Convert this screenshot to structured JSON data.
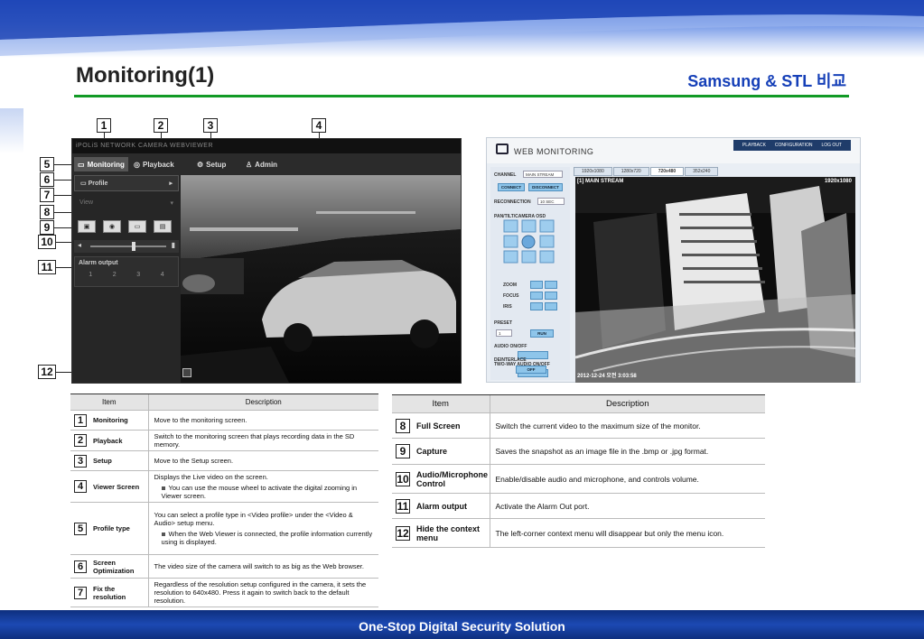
{
  "slide": {
    "title": "Monitoring(1)",
    "subtitle": "Samsung & STL 비교",
    "footer": "One-Stop Digital Security Solution"
  },
  "viewer": {
    "brand": "iPOLiS NETWORK CAMERA WEBVIEWER",
    "tabs": [
      "Monitoring",
      "Playback",
      "Setup",
      "Admin"
    ],
    "profile_label": "Profile",
    "view_label": "View",
    "buttons": [
      "▣",
      "◉",
      "▭",
      "▤"
    ],
    "alarm_title": "Alarm output",
    "alarm_cells": [
      "1",
      "2",
      "3",
      "4"
    ],
    "callouts": [
      "1",
      "2",
      "3",
      "4",
      "5",
      "6",
      "7",
      "8",
      "9",
      "10",
      "11",
      "12"
    ]
  },
  "web_monitoring": {
    "title": "WEB MONITORING",
    "menu": [
      "PLAYBACK",
      "CONFIGURATION",
      "LOG OUT"
    ],
    "tabs": [
      "1920x1080",
      "1280x720",
      "720x480",
      "352x240"
    ],
    "labels": {
      "channel": "CHANNEL",
      "channel_value": "MAIN STREAM",
      "connect": "CONNECT",
      "disconnect": "DISCONNECT",
      "reconnection": "RECONNECTION",
      "reconnection_value": "10 SEC",
      "ptz": "PAN/TILT/CAMERA OSD",
      "zoom": "ZOOM",
      "focus": "FOCUS",
      "iris": "IRIS",
      "preset": "PRESET",
      "preset_value": "1",
      "run": "RUN",
      "audio": "AUDIO ON/OFF",
      "two_way": "TWO-WAY AUDIO ON/OFF",
      "deinterlace": "DEINTERLACE",
      "off": "OFF"
    },
    "overlay": {
      "stream": "[1] MAIN STREAM",
      "resolution": "1920x1080",
      "timestamp": "2012-12-24 오전 3:03:58"
    }
  },
  "table_left": {
    "headers": {
      "item": "Item",
      "description": "Description"
    },
    "rows": [
      {
        "num": "1",
        "item": "Monitoring",
        "desc": "Move to the monitoring screen.",
        "note": ""
      },
      {
        "num": "2",
        "item": "Playback",
        "desc": "Switch to the monitoring screen that plays recording data in the SD memory.",
        "note": ""
      },
      {
        "num": "3",
        "item": "Setup",
        "desc": "Move to the Setup screen.",
        "note": ""
      },
      {
        "num": "4",
        "item": "Viewer Screen",
        "desc": "Displays the Live video on the screen.",
        "note": "You can use the mouse wheel to activate the digital zooming in Viewer screen."
      },
      {
        "num": "5",
        "item": "Profile type",
        "desc": "You can select a profile type in <Video profile> under the <Video & Audio> setup menu.",
        "note": "When the Web Viewer is connected, the profile information currently using is displayed."
      },
      {
        "num": "6",
        "item": "Screen Optimization",
        "desc": "The video size of the camera will switch to as big as the Web browser.",
        "note": ""
      },
      {
        "num": "7",
        "item": "Fix the resolution",
        "desc": "Regardless of the resolution setup configured in the camera, it sets the resolution to 640x480. Press it again to switch back to the default resolution.",
        "note": ""
      }
    ]
  },
  "table_right": {
    "headers": {
      "item": "Item",
      "description": "Description"
    },
    "rows": [
      {
        "num": "8",
        "item": "Full Screen",
        "desc": "Switch the current video to the maximum size of the monitor."
      },
      {
        "num": "9",
        "item": "Capture",
        "desc": "Saves the snapshot as an image file in the .bmp or .jpg format."
      },
      {
        "num": "10",
        "item": "Audio/Microphone Control",
        "desc": "Enable/disable audio and microphone, and controls volume."
      },
      {
        "num": "11",
        "item": "Alarm output",
        "desc": "Activate the Alarm Out port."
      },
      {
        "num": "12",
        "item": "Hide the context menu",
        "desc": "The left-corner context menu will disappear but only the menu icon."
      }
    ]
  }
}
